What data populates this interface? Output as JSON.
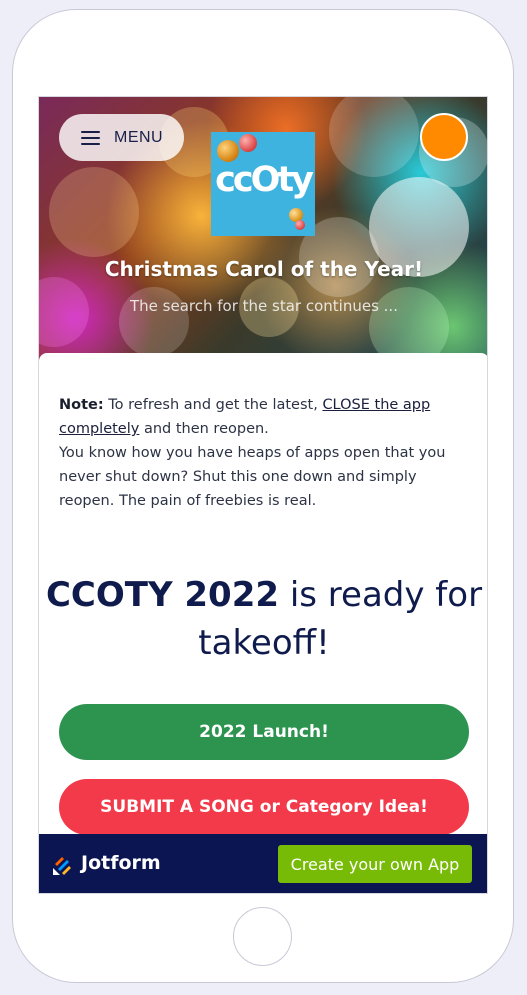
{
  "header": {
    "menu_label": "MENU",
    "logo_text": "ccOty",
    "title": "Christmas Carol of the Year!",
    "subtitle": "The search for the star continues ..."
  },
  "note": {
    "label": "Note:",
    "text_1": " To refresh and get the latest,  ",
    "link": "CLOSE the app completely",
    "text_2": " and then reopen.",
    "text_3": "You know how you have heaps of apps open that you never shut down? Shut this one down and simply reopen. The pain of freebies is real."
  },
  "headline": {
    "bold": "CCOTY 2022",
    "rest": " is ready for takeoff!"
  },
  "buttons": {
    "launch": "2022 Launch!",
    "submit": "SUBMIT A SONG or Category Idea!"
  },
  "footer": {
    "brand": "Jotform",
    "create": "Create your own App"
  },
  "colors": {
    "launch": "#2d9450",
    "submit": "#f23a4a",
    "footer_bg": "#0a1551",
    "create": "#78bb07",
    "avatar": "#ff8a00"
  },
  "icons": [
    "hamburger-icon",
    "avatar-icon",
    "jotform-logo-icon",
    "home-button"
  ]
}
